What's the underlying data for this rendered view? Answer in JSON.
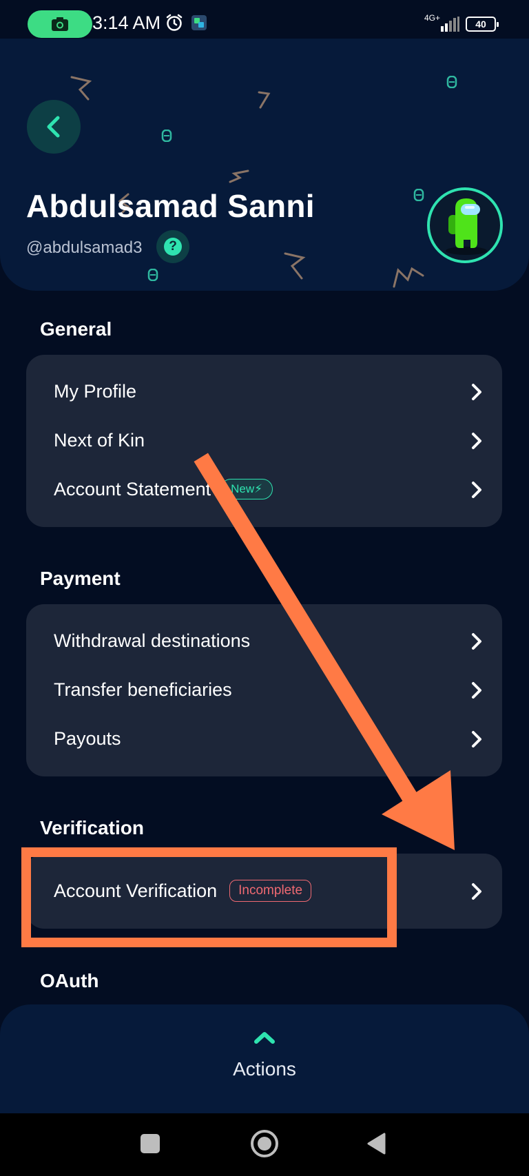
{
  "status_bar": {
    "time": "3:14 AM",
    "network": "4G+",
    "battery": "40",
    "icons": [
      "camera-icon",
      "alarm-icon",
      "app-notification-icon",
      "signal-icon",
      "battery-icon"
    ]
  },
  "header": {
    "name": "Abdulsamad Sanni",
    "handle": "@abdulsamad3",
    "icons": [
      "back-arrow-icon",
      "help-icon",
      "avatar-icon"
    ]
  },
  "sections": {
    "general": {
      "title": "General",
      "items": [
        {
          "label": "My Profile"
        },
        {
          "label": "Next of Kin"
        },
        {
          "label": "Account Statement",
          "badge": "New⚡"
        }
      ]
    },
    "payment": {
      "title": "Payment",
      "items": [
        {
          "label": "Withdrawal destinations"
        },
        {
          "label": "Transfer beneficiaries"
        },
        {
          "label": "Payouts"
        }
      ]
    },
    "verification": {
      "title": "Verification",
      "items": [
        {
          "label": "Account Verification",
          "badge": "Incomplete"
        }
      ]
    },
    "oauth": {
      "title": "OAuth"
    }
  },
  "actions": {
    "label": "Actions"
  },
  "colors": {
    "background": "#030d22",
    "header": "#061a3a",
    "card": "#1d2639",
    "accent": "#2fe3b0",
    "badge_incomplete": "#f06a72",
    "annotation": "#ff7a45"
  }
}
